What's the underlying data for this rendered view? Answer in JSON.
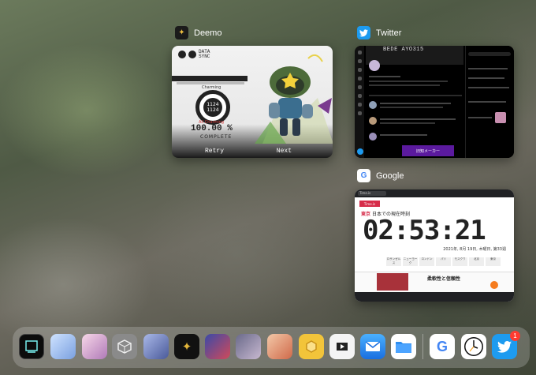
{
  "switcher": {
    "deemo": {
      "app_name": "Deemo",
      "sync_label": "DATA SYNC",
      "charming_label": "Charming",
      "combo": "1124",
      "combo_total": "1124",
      "all_charming_label": "All Charming",
      "percent": "100.00 %",
      "complete_label": "COMPLETE",
      "retry_label": "Retry",
      "next_label": "Next"
    },
    "twitter": {
      "app_name": "Twitter",
      "banner_text": "BEDE AYO315",
      "button_text": "旧知メーカー"
    },
    "google": {
      "app_name": "Google",
      "tab_text": "Time.is",
      "red_label": "Time.is",
      "city": "東京",
      "city_caption": "日本での現在時刻",
      "time": "02:53:21",
      "date": "2021年, 8月 19日, 木曜日, 第33週",
      "cities": [
        "ロサンゼルス",
        "ニューヨーク",
        "ロンドン",
        "パリ",
        "モスクワ",
        "北京",
        "東京"
      ],
      "ad_title": "柔軟性と信頼性"
    }
  },
  "dock": {
    "twitter_badge": "1"
  },
  "colors": {
    "twitter_blue": "#1d9bf0",
    "deemo_dark": "#222222",
    "time_red": "#d62d4a"
  }
}
